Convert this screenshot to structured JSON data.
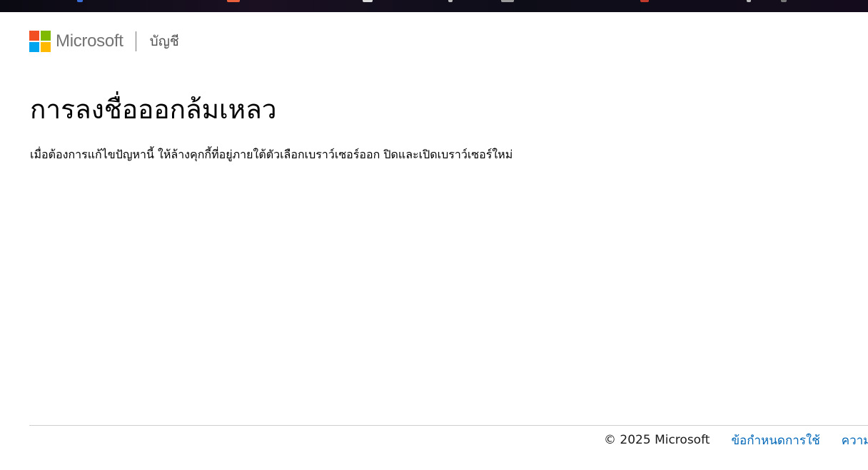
{
  "header": {
    "brand": "Microsoft",
    "section": "บัญชี",
    "logo_colors": [
      "#f25022",
      "#7fba00",
      "#00a4ef",
      "#ffb900"
    ]
  },
  "main": {
    "title": "การลงชื่อออกล้มเหลว",
    "message": "เมื่อต้องการแก้ไขปัญหานี้ ให้ล้างคุกกี้ที่อยู่ภายใต้ตัวเลือกเบราว์เซอร์ออก ปิดและเปิดเบราว์เซอร์ใหม่"
  },
  "footer": {
    "copyright": "© 2025 Microsoft",
    "links": [
      "ข้อกำหนดการใช้",
      "ความเป็นส่วนตัวและคุกกี้"
    ]
  },
  "colors": {
    "link": "#0067b8",
    "brand_text": "#737373"
  }
}
